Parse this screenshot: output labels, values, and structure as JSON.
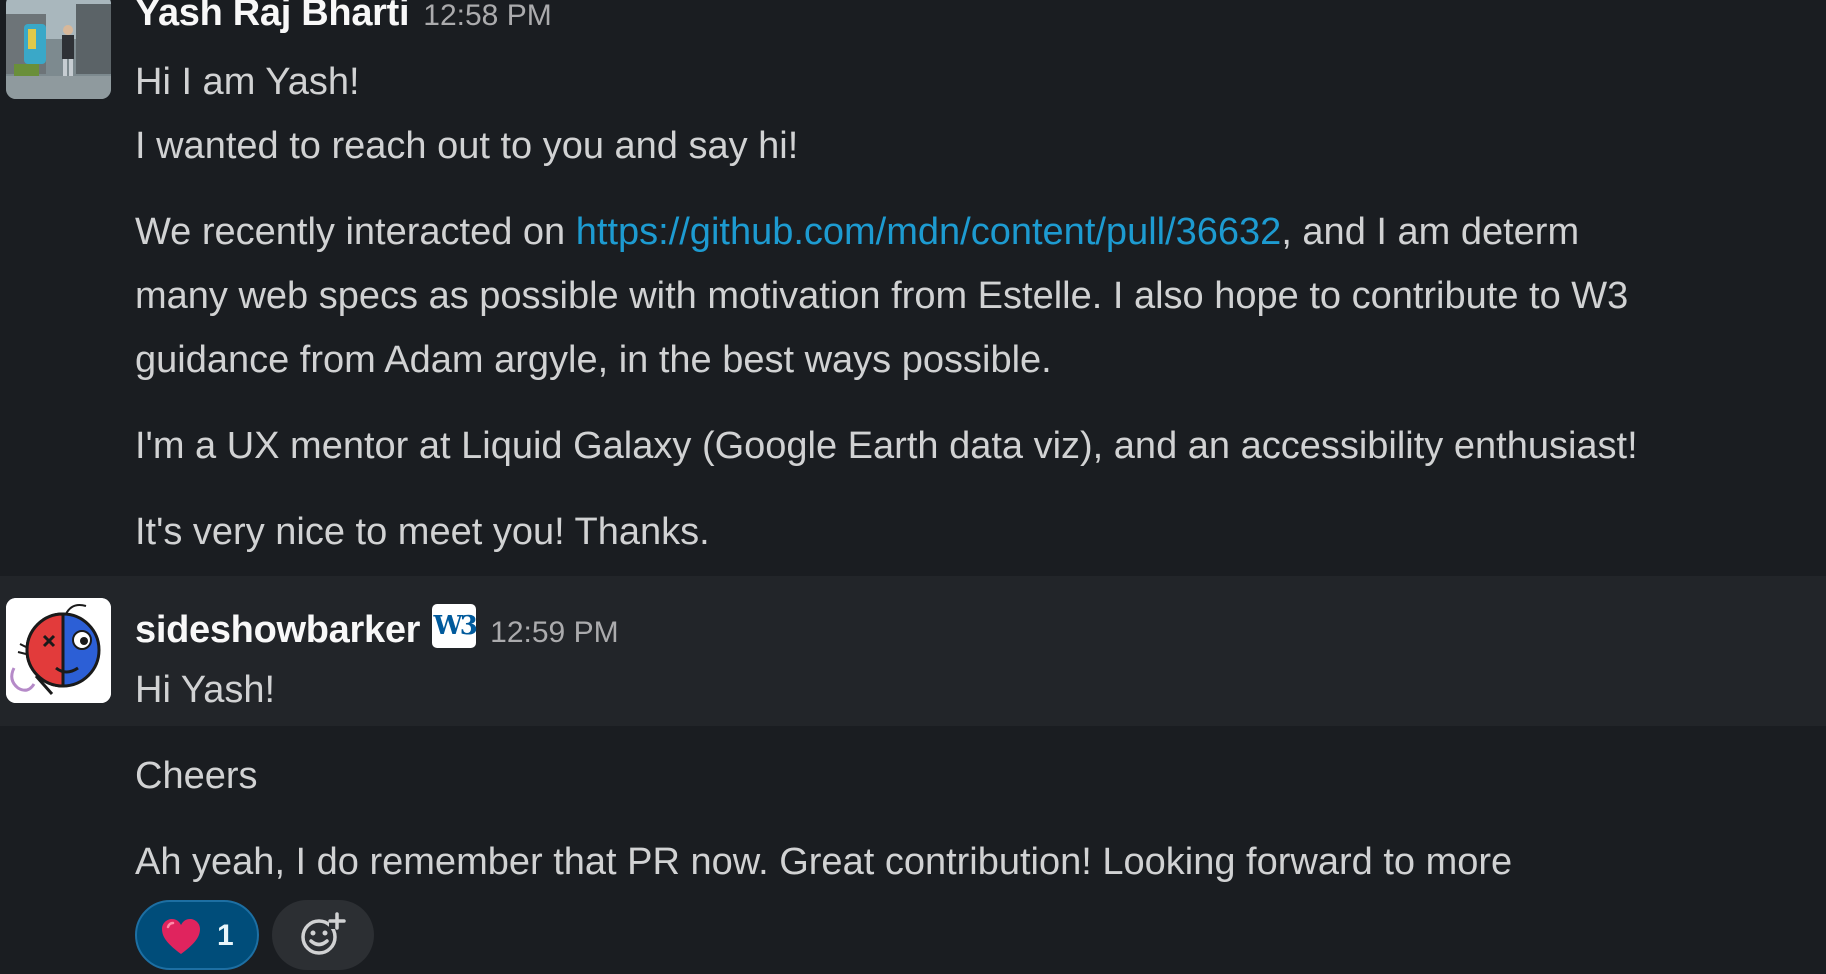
{
  "messages": [
    {
      "author": "Yash Raj Bharti",
      "time": "12:58 PM",
      "lines": {
        "l1": "Hi I am Yash!",
        "l2": "I wanted to reach out to you and say hi!",
        "l3_before": "We recently interacted on ",
        "l3_link": "https://github.com/mdn/content/pull/36632",
        "l3_after": ", and I am determ",
        "l4": "many web specs as possible with motivation from Estelle. I also hope to contribute to W3",
        "l5": "guidance from Adam argyle, in the best ways possible.",
        "l6": "I'm a UX mentor at Liquid Galaxy (Google Earth data viz), and an accessibility enthusiast!",
        "l7": "It's very nice to meet you! Thanks."
      }
    },
    {
      "author": "sideshowbarker",
      "badge": "W3",
      "time": "12:59 PM",
      "lines": {
        "l1": "Hi Yash!",
        "l2": "Cheers",
        "l3": "Ah yeah, I do remember that PR now. Great contribution! Looking forward to more"
      },
      "reactions": [
        {
          "emoji": "heart-icon",
          "count": "1"
        }
      ]
    }
  ],
  "colors": {
    "background": "#1a1d21",
    "hover_band": "#222529",
    "link": "#1d9bd1",
    "reaction_bg": "#004d7a",
    "username": "#f8f8f8",
    "timestamp": "#ababad"
  }
}
